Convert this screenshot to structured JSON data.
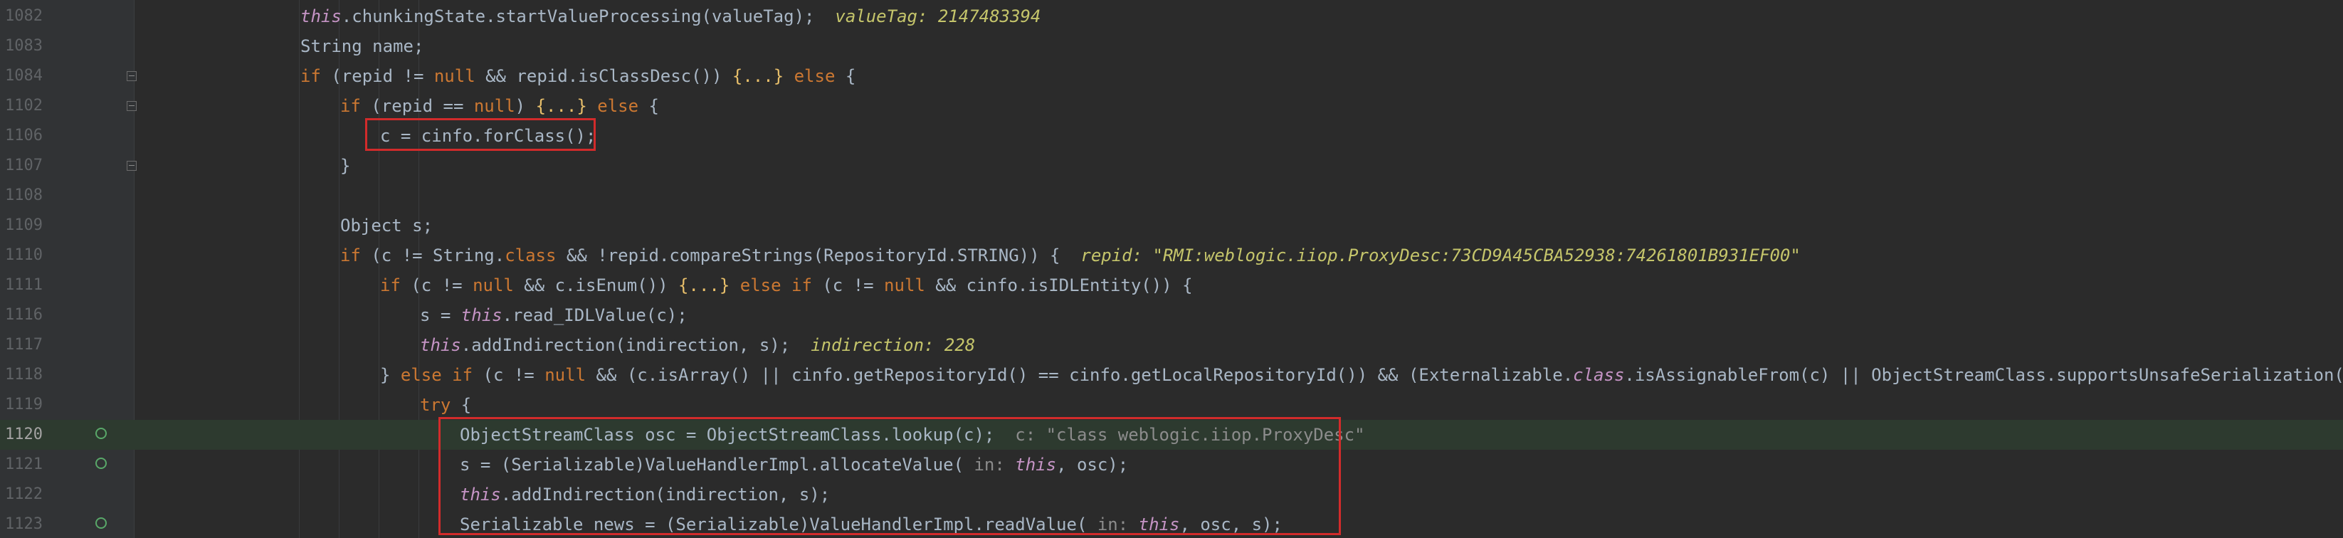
{
  "editor": {
    "lines": [
      {
        "num": "1082",
        "indent": 0,
        "segments": [
          {
            "t": "this",
            "c": "th"
          },
          {
            "t": ".chunkingState.startValueProcessing(valueTag);",
            "c": "id"
          },
          {
            "t": "  valueTag: 2147483394",
            "c": "ann"
          }
        ]
      },
      {
        "num": "1083",
        "indent": 0,
        "segments": [
          {
            "t": "String name;",
            "c": "id"
          }
        ]
      },
      {
        "num": "1084",
        "indent": 0,
        "fold": true,
        "segments": [
          {
            "t": "if",
            "c": "kw"
          },
          {
            "t": " (repid != ",
            "c": "id"
          },
          {
            "t": "null",
            "c": "nl"
          },
          {
            "t": " && repid.isClassDesc()) ",
            "c": "id"
          },
          {
            "t": "{...}",
            "c": "br"
          },
          {
            "t": " else",
            "c": "kw"
          },
          {
            "t": " {",
            "c": "id"
          }
        ]
      },
      {
        "num": "1102",
        "indent": 1,
        "fold": true,
        "segments": [
          {
            "t": "if",
            "c": "kw"
          },
          {
            "t": " (repid == ",
            "c": "id"
          },
          {
            "t": "null",
            "c": "nl"
          },
          {
            "t": ") ",
            "c": "id"
          },
          {
            "t": "{...}",
            "c": "br"
          },
          {
            "t": " else",
            "c": "kw"
          },
          {
            "t": " {",
            "c": "id"
          }
        ]
      },
      {
        "num": "1106",
        "indent": 2,
        "segments": [
          {
            "t": "c = cinfo.forClass();",
            "c": "id"
          }
        ]
      },
      {
        "num": "1107",
        "indent": 1,
        "fold": true,
        "segments": [
          {
            "t": "}",
            "c": "id"
          }
        ]
      },
      {
        "num": "1108",
        "indent": 0,
        "segments": []
      },
      {
        "num": "1109",
        "indent": 1,
        "segments": [
          {
            "t": "Object s;",
            "c": "id"
          }
        ]
      },
      {
        "num": "1110",
        "indent": 1,
        "segments": [
          {
            "t": "if",
            "c": "kw"
          },
          {
            "t": " (c != String.",
            "c": "id"
          },
          {
            "t": "class",
            "c": "kw"
          },
          {
            "t": " && !repid.compareStrings(RepositoryId.STRING)) {",
            "c": "id"
          },
          {
            "t": "  repid: \"RMI:weblogic.iiop.ProxyDesc:73CD9A45CBA52938:74261801B931EF00\"",
            "c": "ann"
          }
        ]
      },
      {
        "num": "1111",
        "indent": 2,
        "segments": [
          {
            "t": "if",
            "c": "kw"
          },
          {
            "t": " (c != ",
            "c": "id"
          },
          {
            "t": "null",
            "c": "nl"
          },
          {
            "t": " && c.isEnum()) ",
            "c": "id"
          },
          {
            "t": "{...}",
            "c": "br"
          },
          {
            "t": " else if",
            "c": "kw"
          },
          {
            "t": " (c != ",
            "c": "id"
          },
          {
            "t": "null",
            "c": "nl"
          },
          {
            "t": " && cinfo.isIDLEntity()) {",
            "c": "id"
          }
        ]
      },
      {
        "num": "1116",
        "indent": 3,
        "segments": [
          {
            "t": "s = ",
            "c": "id"
          },
          {
            "t": "this",
            "c": "th"
          },
          {
            "t": ".read_IDLValue(c);",
            "c": "id"
          }
        ]
      },
      {
        "num": "1117",
        "indent": 3,
        "segments": [
          {
            "t": "this",
            "c": "th"
          },
          {
            "t": ".addIndirection(indirection, s);",
            "c": "id"
          },
          {
            "t": "  indirection: 228",
            "c": "ann"
          }
        ]
      },
      {
        "num": "1118",
        "indent": 2,
        "segments": [
          {
            "t": "} ",
            "c": "id"
          },
          {
            "t": "else if",
            "c": "kw"
          },
          {
            "t": " (c != ",
            "c": "id"
          },
          {
            "t": "null",
            "c": "nl"
          },
          {
            "t": " && (c.isArray() || cinfo.getRepositoryId() == cinfo.getLocalRepositoryId()) && (Externalizable.",
            "c": "id"
          },
          {
            "t": "class",
            "c": "th"
          },
          {
            "t": ".isAssignableFrom(c) || ObjectStreamClass.supportsUnsafeSerialization())) {",
            "c": "id"
          }
        ]
      },
      {
        "num": "1119",
        "indent": 3,
        "segments": [
          {
            "t": "try",
            "c": "kw"
          },
          {
            "t": " {",
            "c": "id"
          }
        ]
      },
      {
        "num": "1120",
        "indent": 4,
        "bp": true,
        "current": true,
        "segments": [
          {
            "t": "ObjectStreamClass osc = ObjectStreamClass.lookup(c);",
            "c": "id"
          },
          {
            "t": "  c: \"class weblogic.iiop.ProxyDesc\"",
            "c": "hint"
          }
        ]
      },
      {
        "num": "1121",
        "indent": 4,
        "bp": true,
        "segments": [
          {
            "t": "s = (Serializable)ValueHandlerImpl.allocateValue(",
            "c": "id"
          },
          {
            "t": " in: ",
            "c": "hint"
          },
          {
            "t": "this",
            "c": "th"
          },
          {
            "t": ", osc);",
            "c": "id"
          }
        ]
      },
      {
        "num": "1122",
        "indent": 4,
        "segments": [
          {
            "t": "this",
            "c": "th"
          },
          {
            "t": ".addIndirection(indirection, s);",
            "c": "id"
          }
        ]
      },
      {
        "num": "1123",
        "indent": 4,
        "bp": true,
        "segments": [
          {
            "t": "Serializable news = (Serializable)ValueHandlerImpl.readValue(",
            "c": "id"
          },
          {
            "t": " in: ",
            "c": "hint"
          },
          {
            "t": "this",
            "c": "th"
          },
          {
            "t": ", osc, s);",
            "c": "id"
          }
        ]
      }
    ]
  }
}
